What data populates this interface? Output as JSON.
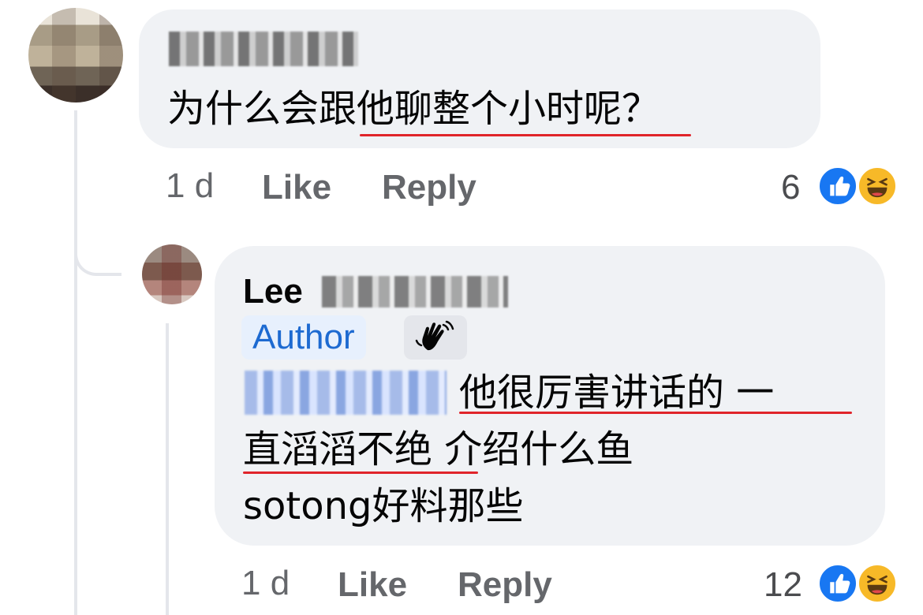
{
  "comments": [
    {
      "text": "为什么会跟他聊整个小时呢？",
      "time": "1 d",
      "like_label": "Like",
      "reply_label": "Reply",
      "reaction_count": "6",
      "reactions": [
        "like-icon",
        "haha-icon"
      ]
    },
    {
      "author_first": "Lee",
      "author_badge": "Author",
      "line1": "他很厉害讲话的 一",
      "line2": "直滔滔不绝 介绍什么鱼",
      "line3": "sotong好料那些",
      "time": "1 d",
      "like_label": "Like",
      "reply_label": "Reply",
      "reaction_count": "12",
      "reactions": [
        "like-icon",
        "haha-icon"
      ]
    }
  ],
  "colors": {
    "bubble": "#f0f2f5",
    "author_badge_text": "#1d6ad1",
    "underline": "#e0242a",
    "like_blue": "#1877f2",
    "haha_yellow": "#f7b928"
  }
}
